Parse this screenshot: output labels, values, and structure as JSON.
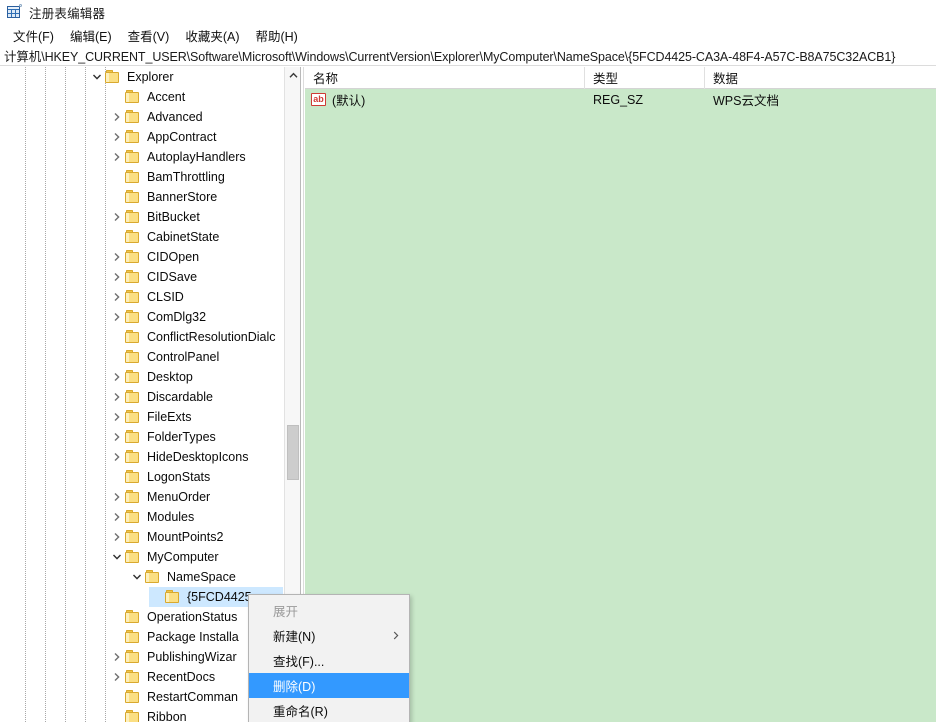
{
  "window": {
    "title": "注册表编辑器",
    "icon": "registry-editor-icon"
  },
  "menubar": {
    "items": [
      {
        "label": "文件(F)",
        "name": "menu-file"
      },
      {
        "label": "编辑(E)",
        "name": "menu-edit"
      },
      {
        "label": "查看(V)",
        "name": "menu-view"
      },
      {
        "label": "收藏夹(A)",
        "name": "menu-favorites"
      },
      {
        "label": "帮助(H)",
        "name": "menu-help"
      }
    ]
  },
  "address": {
    "path": "计算机\\HKEY_CURRENT_USER\\Software\\Microsoft\\Windows\\CurrentVersion\\Explorer\\MyComputer\\NameSpace\\{5FCD4425-CA3A-48F4-A57C-B8A75C32ACB1}"
  },
  "tree": {
    "scrollbar": {
      "up_arrow": "chevron-up-icon"
    },
    "nodes": [
      {
        "label": "Explorer",
        "indent": 5,
        "state": "expanded",
        "selected": false
      },
      {
        "label": "Accent",
        "indent": 6,
        "state": "leaf",
        "selected": false
      },
      {
        "label": "Advanced",
        "indent": 6,
        "state": "collapsed",
        "selected": false
      },
      {
        "label": "AppContract",
        "indent": 6,
        "state": "collapsed",
        "selected": false
      },
      {
        "label": "AutoplayHandlers",
        "indent": 6,
        "state": "collapsed",
        "selected": false
      },
      {
        "label": "BamThrottling",
        "indent": 6,
        "state": "leaf",
        "selected": false
      },
      {
        "label": "BannerStore",
        "indent": 6,
        "state": "leaf",
        "selected": false
      },
      {
        "label": "BitBucket",
        "indent": 6,
        "state": "collapsed",
        "selected": false
      },
      {
        "label": "CabinetState",
        "indent": 6,
        "state": "leaf",
        "selected": false
      },
      {
        "label": "CIDOpen",
        "indent": 6,
        "state": "collapsed",
        "selected": false
      },
      {
        "label": "CIDSave",
        "indent": 6,
        "state": "collapsed",
        "selected": false
      },
      {
        "label": "CLSID",
        "indent": 6,
        "state": "collapsed",
        "selected": false
      },
      {
        "label": "ComDlg32",
        "indent": 6,
        "state": "collapsed",
        "selected": false
      },
      {
        "label": "ConflictResolutionDialc",
        "indent": 6,
        "state": "leaf",
        "selected": false
      },
      {
        "label": "ControlPanel",
        "indent": 6,
        "state": "leaf",
        "selected": false
      },
      {
        "label": "Desktop",
        "indent": 6,
        "state": "collapsed",
        "selected": false
      },
      {
        "label": "Discardable",
        "indent": 6,
        "state": "collapsed",
        "selected": false
      },
      {
        "label": "FileExts",
        "indent": 6,
        "state": "collapsed",
        "selected": false
      },
      {
        "label": "FolderTypes",
        "indent": 6,
        "state": "collapsed",
        "selected": false
      },
      {
        "label": "HideDesktopIcons",
        "indent": 6,
        "state": "collapsed",
        "selected": false
      },
      {
        "label": "LogonStats",
        "indent": 6,
        "state": "leaf",
        "selected": false
      },
      {
        "label": "MenuOrder",
        "indent": 6,
        "state": "collapsed",
        "selected": false
      },
      {
        "label": "Modules",
        "indent": 6,
        "state": "collapsed",
        "selected": false
      },
      {
        "label": "MountPoints2",
        "indent": 6,
        "state": "collapsed",
        "selected": false
      },
      {
        "label": "MyComputer",
        "indent": 6,
        "state": "expanded",
        "selected": false
      },
      {
        "label": "NameSpace",
        "indent": 7,
        "state": "expanded",
        "selected": false
      },
      {
        "label": "{5FCD4425",
        "indent": 8,
        "state": "leaf",
        "selected": true
      },
      {
        "label": "OperationStatus",
        "indent": 6,
        "state": "leaf",
        "selected": false
      },
      {
        "label": "Package Installa",
        "indent": 6,
        "state": "leaf",
        "selected": false
      },
      {
        "label": "PublishingWizar",
        "indent": 6,
        "state": "collapsed",
        "selected": false
      },
      {
        "label": "RecentDocs",
        "indent": 6,
        "state": "collapsed",
        "selected": false
      },
      {
        "label": "RestartComman",
        "indent": 6,
        "state": "leaf",
        "selected": false
      },
      {
        "label": "Ribbon",
        "indent": 6,
        "state": "leaf",
        "selected": false
      }
    ]
  },
  "list": {
    "columns": [
      {
        "label": "名称",
        "name": "column-name"
      },
      {
        "label": "类型",
        "name": "column-type"
      },
      {
        "label": "数据",
        "name": "column-data"
      }
    ],
    "rows": [
      {
        "icon": "string-value-icon",
        "icon_text": "ab",
        "name": "(默认)",
        "type": "REG_SZ",
        "data": "WPS云文档"
      }
    ]
  },
  "context_menu": {
    "items": [
      {
        "label": "展开",
        "name": "context-menu-expand",
        "state": "disabled",
        "submenu": false
      },
      {
        "label": "新建(N)",
        "name": "context-menu-new",
        "state": "normal",
        "submenu": true
      },
      {
        "label": "查找(F)...",
        "name": "context-menu-find",
        "state": "normal",
        "submenu": false
      },
      {
        "label": "删除(D)",
        "name": "context-menu-delete",
        "state": "highlight",
        "submenu": false
      },
      {
        "label": "重命名(R)",
        "name": "context-menu-rename",
        "state": "normal",
        "submenu": false
      }
    ]
  },
  "colors": {
    "list_background": "#c9e8c9",
    "selection": "#cde8ff",
    "menu_highlight": "#3399ff",
    "folder": "#fbdf83"
  }
}
